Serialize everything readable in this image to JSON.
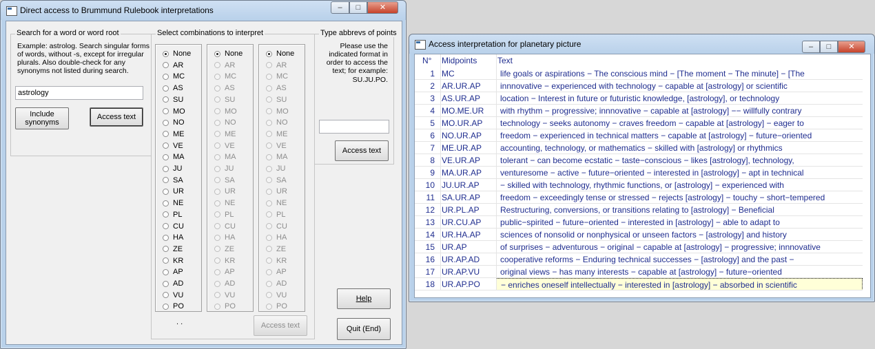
{
  "left_window": {
    "title": "Direct access to Brummund Rulebook interpretations",
    "controls": {
      "minimize": "‒",
      "maximize": "□",
      "close": "✕"
    },
    "search_group": {
      "label": "Search for a word or word root",
      "instructions": "Example: astrolog. Search singular forms of words, without -s, except for irregular plurals. Also double-check for any synonyms not listed during search.",
      "input_value": "astrology",
      "include_synonyms_label": "Include synonyms",
      "access_text_label": "Access text"
    },
    "combo_group": {
      "label": "Select combinations to interpret",
      "options": [
        "None",
        "AR",
        "MC",
        "AS",
        "SU",
        "MO",
        "NO",
        "ME",
        "VE",
        "MA",
        "JU",
        "SA",
        "UR",
        "NE",
        "PL",
        "CU",
        "HA",
        "ZE",
        "KR",
        "AP",
        "AD",
        "VU",
        "PO"
      ],
      "dots": ". .",
      "access_text_label": "Access text"
    },
    "abbrev_group": {
      "label": "Type abbrevs of points",
      "instructions": "Please use the indicated format in order to access the text; for example:",
      "example": "SU.JU.PO.",
      "input_value": "",
      "access_text_label": "Access text"
    },
    "help_label": "Help",
    "quit_label": "Quit (End)"
  },
  "right_window": {
    "title": "Access interpretation for planetary picture",
    "controls": {
      "minimize": "‒",
      "maximize": "□",
      "close": "✕"
    },
    "table": {
      "headers": {
        "num": "N°",
        "midpoints": "Midpoints",
        "text": "Text"
      },
      "rows": [
        {
          "n": "1",
          "mid": "MC",
          "text": "life goals or aspirations − The conscious mind − [The moment − The minute] − [The"
        },
        {
          "n": "2",
          "mid": "AR.UR.AP",
          "text": "innnovative − experienced with technology − capable at [astrology] or scientific"
        },
        {
          "n": "3",
          "mid": "AS.UR.AP",
          "text": "location − Interest in future or futuristic knowledge, [astrology], or technology"
        },
        {
          "n": "4",
          "mid": "MO.ME.UR",
          "text": "with rhythm − progressive; innnovative − capable at [astrology] −− willfully contrary"
        },
        {
          "n": "5",
          "mid": "MO.UR.AP",
          "text": "technology − seeks autonomy − craves freedom − capable at [astrology] − eager to"
        },
        {
          "n": "6",
          "mid": "NO.UR.AP",
          "text": "freedom − experienced in technical matters − capable at [astrology] − future−oriented"
        },
        {
          "n": "7",
          "mid": "ME.UR.AP",
          "text": "accounting, technology, or mathematics − skilled with [astrology] or rhythmics"
        },
        {
          "n": "8",
          "mid": "VE.UR.AP",
          "text": "tolerant − can become ecstatic − taste−conscious − likes [astrology], technology,"
        },
        {
          "n": "9",
          "mid": "MA.UR.AP",
          "text": "venturesome − active − future−oriented − interested in [astrology] − apt in technical"
        },
        {
          "n": "10",
          "mid": "JU.UR.AP",
          "text": " − skilled with technology, rhythmic functions, or [astrology] − experienced with"
        },
        {
          "n": "11",
          "mid": "SA.UR.AP",
          "text": "freedom − exceedingly tense or stressed − rejects [astrology] − touchy − short−tempered"
        },
        {
          "n": "12",
          "mid": "UR.PL.AP",
          "text": "Restructuring, conversions, or transitions relating to [astrology] − Beneficial"
        },
        {
          "n": "13",
          "mid": "UR.CU.AP",
          "text": "public−spirited − future−oriented − interested in [astrology] − able to adapt to"
        },
        {
          "n": "14",
          "mid": "UR.HA.AP",
          "text": "sciences of nonsolid or nonphysical or unseen factors − [astrology] and history"
        },
        {
          "n": "15",
          "mid": "UR.AP",
          "text": "of surprises − adventurous − original − capable at [astrology] − progressive; innnovative"
        },
        {
          "n": "16",
          "mid": "UR.AP.AD",
          "text": "cooperative reforms − Enduring technical successes − [astrology] and the past −"
        },
        {
          "n": "17",
          "mid": "UR.AP.VU",
          "text": "original views − has many interests − capable at [astrology] − future−oriented"
        },
        {
          "n": "18",
          "mid": "UR.AP.PO",
          "text": " − enriches oneself intellectually − interested in [astrology] − absorbed in scientific"
        }
      ]
    }
  }
}
